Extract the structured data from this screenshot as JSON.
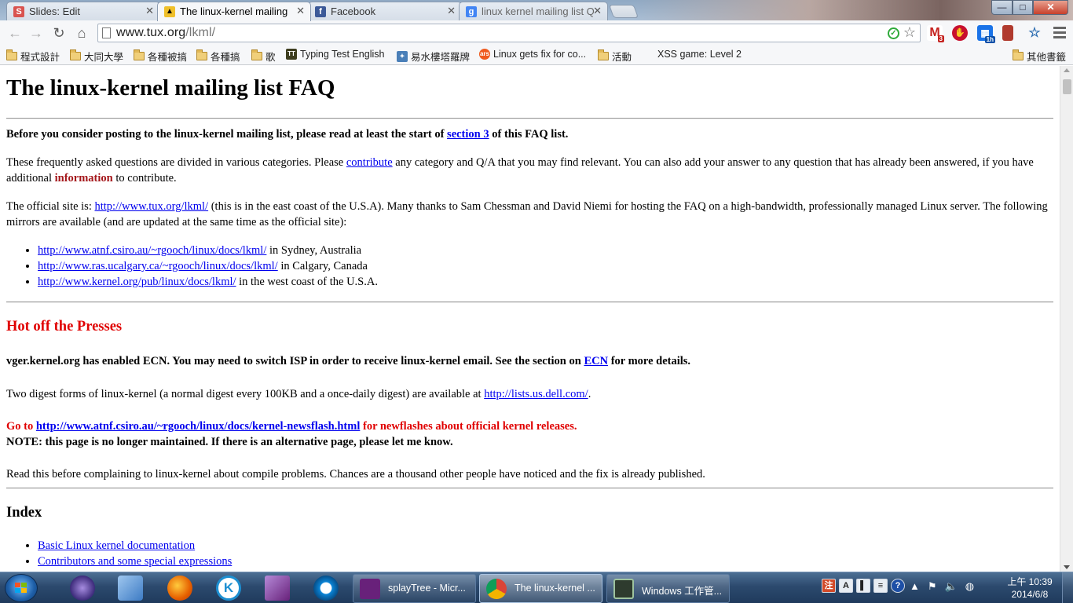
{
  "tabs": [
    {
      "title": "Slides: Edit",
      "icon": "slides-icon",
      "color": "#d9534f",
      "glyph": "S"
    },
    {
      "title": "The linux-kernel mailing",
      "icon": "tux-icon",
      "color": "#f0c02a",
      "glyph": "🐧"
    },
    {
      "title": "Facebook",
      "icon": "facebook-icon",
      "color": "#3b5998",
      "glyph": "f"
    },
    {
      "title": "linux kernel mailing list Q",
      "icon": "google-icon",
      "color": "#4285f4",
      "glyph": "g"
    }
  ],
  "window_controls": {
    "minimize": "—",
    "maximize": "□",
    "close": "✕"
  },
  "toolbar": {
    "url_host": "www.tux.org",
    "url_path": "/lkml/",
    "extensions": [
      {
        "name": "gmail-extension-icon",
        "badge": "3",
        "color": "#c5221f"
      },
      {
        "name": "adblock-icon",
        "color": "#c8102e"
      },
      {
        "name": "calendar-extension-icon",
        "badge": "1h",
        "color": "#1a73e8"
      },
      {
        "name": "bookmark-extension-icon",
        "color": "#b03a2e"
      },
      {
        "name": "favorites-extension-icon",
        "color": "#2b6cb0"
      }
    ]
  },
  "bookmarks": [
    {
      "label": "程式設計",
      "type": "folder"
    },
    {
      "label": "大同大學",
      "type": "folder"
    },
    {
      "label": "各種被搞",
      "type": "folder"
    },
    {
      "label": "各種搞",
      "type": "folder"
    },
    {
      "label": "歌",
      "type": "folder"
    },
    {
      "label": "Typing Test English",
      "type": "site"
    },
    {
      "label": "易水樓塔羅牌",
      "type": "site"
    },
    {
      "label": "Linux gets fix for co...",
      "type": "site"
    },
    {
      "label": "活動",
      "type": "folder"
    },
    {
      "label": "XSS game: Level 2",
      "type": "site"
    }
  ],
  "other_bookmarks": "其他書籤",
  "content": {
    "title": "The linux-kernel mailing list FAQ",
    "intro_bold_before": "Before you consider posting to the linux-kernel mailing list, please read at least the start of ",
    "intro_bold_link": "section 3",
    "intro_bold_after": " of this FAQ list.",
    "para1_a": "These frequently asked questions are divided in various categories. Please ",
    "para1_link": "contribute",
    "para1_b": " any category and Q/A that you may find relevant. You can also add your answer to any question that has already been answered, if you have additional ",
    "para1_red": "information",
    "para1_c": " to contribute.",
    "para2_a": "The official site is: ",
    "para2_link": "http://www.tux.org/lkml/",
    "para2_b": " (this is in the east coast of the U.S.A). Many thanks to Sam Chessman and David Niemi for hosting the FAQ on a high-bandwidth, professionally managed Linux server. The following mirrors are available (and are updated at the same time as the official site):",
    "mirrors": [
      {
        "url": "http://www.atnf.csiro.au/~rgooch/linux/docs/lkml/",
        "loc": " in Sydney, Australia"
      },
      {
        "url": "http://www.ras.ucalgary.ca/~rgooch/linux/docs/lkml/",
        "loc": " in Calgary, Canada"
      },
      {
        "url": "http://www.kernel.org/pub/linux/docs/lkml/",
        "loc": " in the west coast of the U.S.A."
      }
    ],
    "hot_heading": "Hot off the Presses",
    "ecn_a": "vger.kernel.org has enabled ECN. You may need to switch ISP in order to receive linux-kernel email. See the section on ",
    "ecn_link": "ECN",
    "ecn_b": " for more details.",
    "digest_a": "Two digest forms of linux-kernel (a normal digest every 100KB and a once-daily digest) are available at ",
    "digest_link": "http://lists.us.dell.com/",
    "digest_b": ".",
    "goto_a": "Go to ",
    "goto_link": "http://www.atnf.csiro.au/~rgooch/linux/docs/kernel-newsflash.html",
    "goto_b": " for newflashes about official kernel releases.",
    "note": "NOTE: this page is no longer maintained. If there is an alternative page, please let me know.",
    "compile": "Read this before complaining to linux-kernel about compile problems. Chances are a thousand other people have noticed and the fix is already published.",
    "index_heading": "Index",
    "index_items": [
      "Basic Linux kernel documentation",
      "Contributors and some special expressions"
    ]
  },
  "taskbar": {
    "pinned": [
      {
        "name": "eclipse-icon",
        "color": "#3c2a7a"
      },
      {
        "name": "virtualbox-icon",
        "color": "#3d7bc4"
      },
      {
        "name": "firefox-icon",
        "color": "#e66000"
      },
      {
        "name": "k-app-icon",
        "color": "#1d8fd1"
      },
      {
        "name": "visual-studio-icon",
        "color": "#68217a"
      },
      {
        "name": "refresh-app-icon",
        "color": "#0a84d6"
      }
    ],
    "tasks": [
      {
        "label": "splayTree - Micr...",
        "icon": "visual-studio-icon",
        "color": "#68217a"
      },
      {
        "label": "The linux-kernel ...",
        "icon": "chrome-icon",
        "color": "#db4437"
      },
      {
        "label": "Windows 工作管...",
        "icon": "task-manager-icon",
        "color": "#3a7a3a"
      }
    ],
    "tray_ime": [
      "A",
      "▌",
      "≡",
      "?"
    ],
    "clock_time": "上午 10:39",
    "clock_date": "2014/6/8"
  }
}
